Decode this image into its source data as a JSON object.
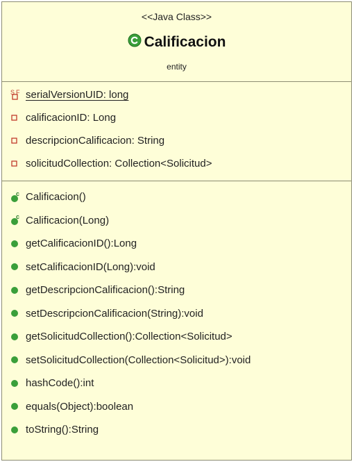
{
  "class": {
    "stereotype": "<<Java Class>>",
    "name": "Calificacion",
    "package": "entity"
  },
  "colors": {
    "background": "#fefed8",
    "border": "#8c8c72",
    "public_method_green": "#3a9f3a",
    "private_field_red": "#c0392b"
  },
  "attributes": [
    {
      "text": "serialVersionUID: long",
      "visibility": "private-static-final",
      "icon": "static-final-field-icon",
      "underlined": true
    },
    {
      "text": "calificacionID: Long",
      "visibility": "private",
      "icon": "private-field-icon"
    },
    {
      "text": "descripcionCalificacion: String",
      "visibility": "private",
      "icon": "private-field-icon"
    },
    {
      "text": "solicitudCollection: Collection<Solicitud>",
      "visibility": "private",
      "icon": "private-field-icon"
    }
  ],
  "operations": [
    {
      "text": "Calificacion()",
      "icon": "constructor-icon"
    },
    {
      "text": "Calificacion(Long)",
      "icon": "constructor-icon"
    },
    {
      "text": "getCalificacionID():Long",
      "icon": "public-method-icon"
    },
    {
      "text": "setCalificacionID(Long):void",
      "icon": "public-method-icon"
    },
    {
      "text": "getDescripcionCalificacion():String",
      "icon": "public-method-icon"
    },
    {
      "text": "setDescripcionCalificacion(String):void",
      "icon": "public-method-icon"
    },
    {
      "text": "getSolicitudCollection():Collection<Solicitud>",
      "icon": "public-method-icon"
    },
    {
      "text": "setSolicitudCollection(Collection<Solicitud>):void",
      "icon": "public-method-icon"
    },
    {
      "text": "hashCode():int",
      "icon": "public-method-icon"
    },
    {
      "text": "equals(Object):boolean",
      "icon": "public-method-icon"
    },
    {
      "text": "toString():String",
      "icon": "public-method-icon"
    }
  ]
}
